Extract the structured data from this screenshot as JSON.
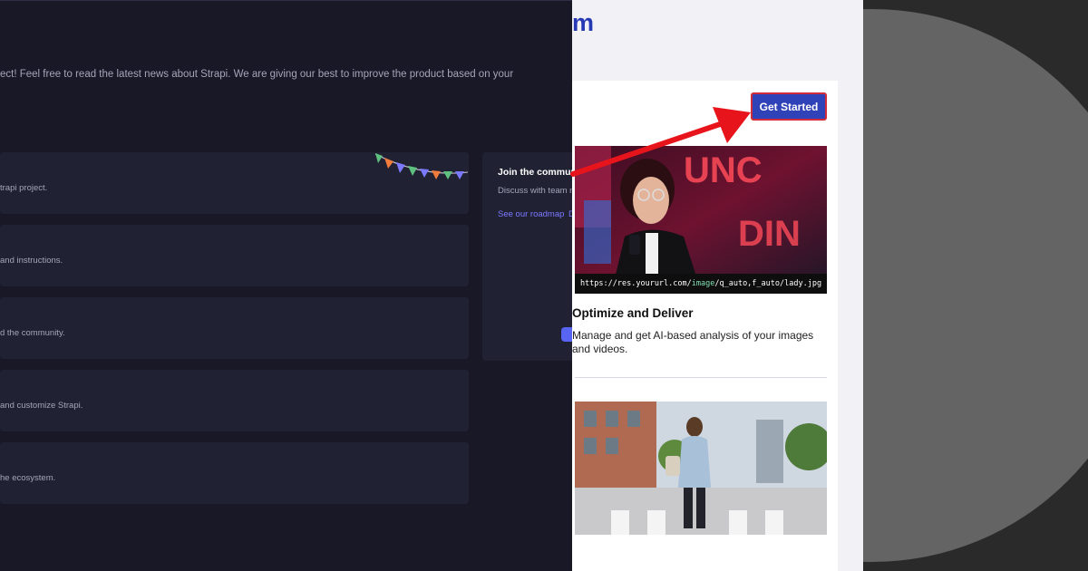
{
  "strapi": {
    "intro_text": "ect! Feel free to read the latest news about Strapi. We are giving our best to improve the product based on your",
    "cards": [
      {
        "text": "trapi project."
      },
      {
        "text": "and instructions."
      },
      {
        "text": "d the community."
      },
      {
        "text": "and customize Strapi."
      },
      {
        "text": "he ecosystem."
      }
    ],
    "community": {
      "title": "Join the commun",
      "description": "Discuss with team m",
      "roadmap_link": "See our roadmap",
      "second_link": "D"
    }
  },
  "webpage": {
    "heading": "m",
    "cta_label": "Get Started",
    "hero_url_prefix": "https://res.yoururl.com/",
    "hero_url_highlight": "image",
    "hero_url_suffix": "/q_auto,f_auto/lady.jpg",
    "feature_title": "Optimize and Deliver",
    "feature_description": "Manage and get AI-based analysis of your images and videos."
  },
  "colors": {
    "strapi_bg": "#181826",
    "strapi_card": "#212134",
    "accent_blue": "#2638b4",
    "arrow_red": "#e8141c"
  }
}
